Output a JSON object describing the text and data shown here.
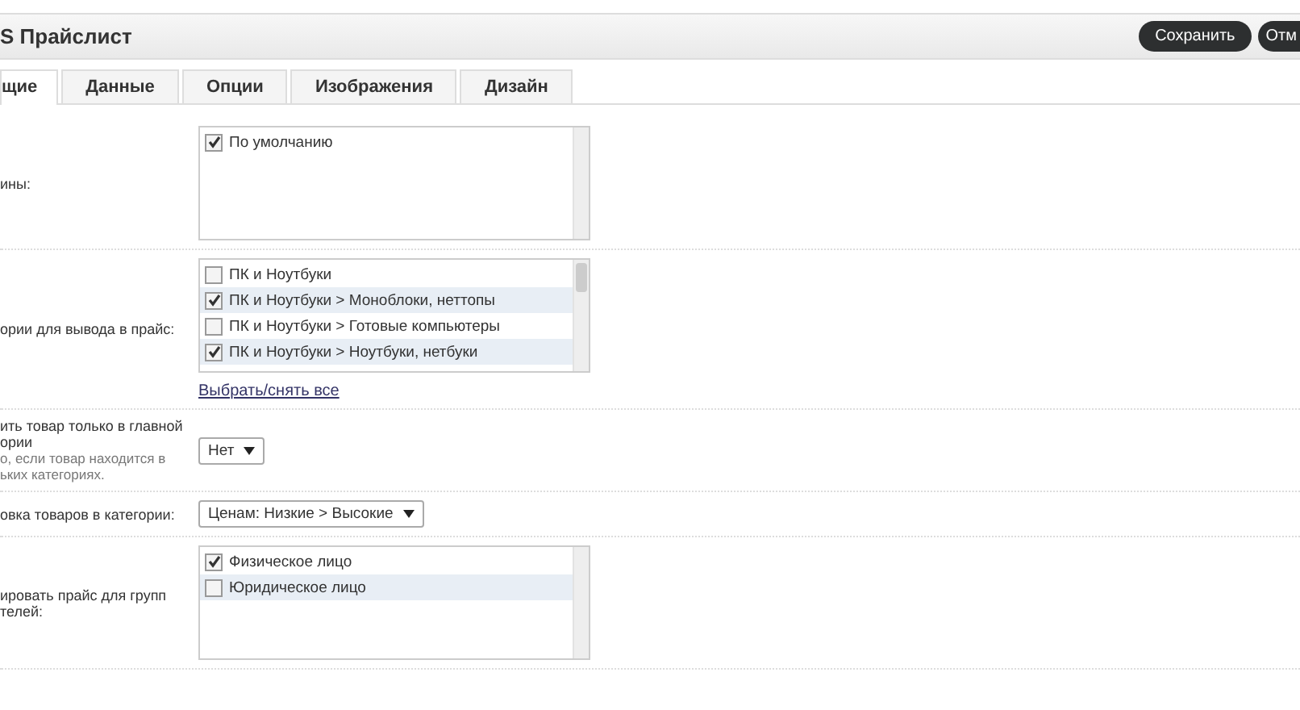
{
  "header": {
    "title": "S Прайслист",
    "buttons": [
      {
        "label": "Сохранить"
      },
      {
        "label": "Отм"
      }
    ]
  },
  "tabs": [
    {
      "label": "щие",
      "selected": true
    },
    {
      "label": "Данные",
      "selected": false
    },
    {
      "label": "Опции",
      "selected": false
    },
    {
      "label": "Изображения",
      "selected": false
    },
    {
      "label": "Дизайн",
      "selected": false
    }
  ],
  "fields": [
    {
      "kind": "checklist",
      "label": "ины:",
      "options": [
        {
          "label": "По умолчанию",
          "checked": true
        }
      ]
    },
    {
      "kind": "checklist",
      "label": "ории для вывода в прайс:",
      "options": [
        {
          "label": "ПК и Ноутбуки",
          "checked": false
        },
        {
          "label": "ПК и Ноутбуки > Моноблоки, неттопы",
          "checked": true
        },
        {
          "label": "ПК и Ноутбуки > Готовые компьютеры",
          "checked": false
        },
        {
          "label": "ПК и Ноутбуки > Ноутбуки, нетбуки",
          "checked": true
        }
      ],
      "link": "Выбрать/снять все"
    },
    {
      "kind": "select",
      "label": "ить товар только в главной\nории",
      "help": "о, если товар находится в\nьких категориях.",
      "value": "Нет"
    },
    {
      "kind": "select",
      "label": "овка товаров в категории:",
      "value": "Ценам: Низкие > Высокие"
    },
    {
      "kind": "checklist",
      "label": "ировать прайс для групп\nтелей:",
      "options": [
        {
          "label": "Физическое лицо",
          "checked": true
        },
        {
          "label": "Юридическое лицо",
          "checked": false
        }
      ]
    }
  ]
}
